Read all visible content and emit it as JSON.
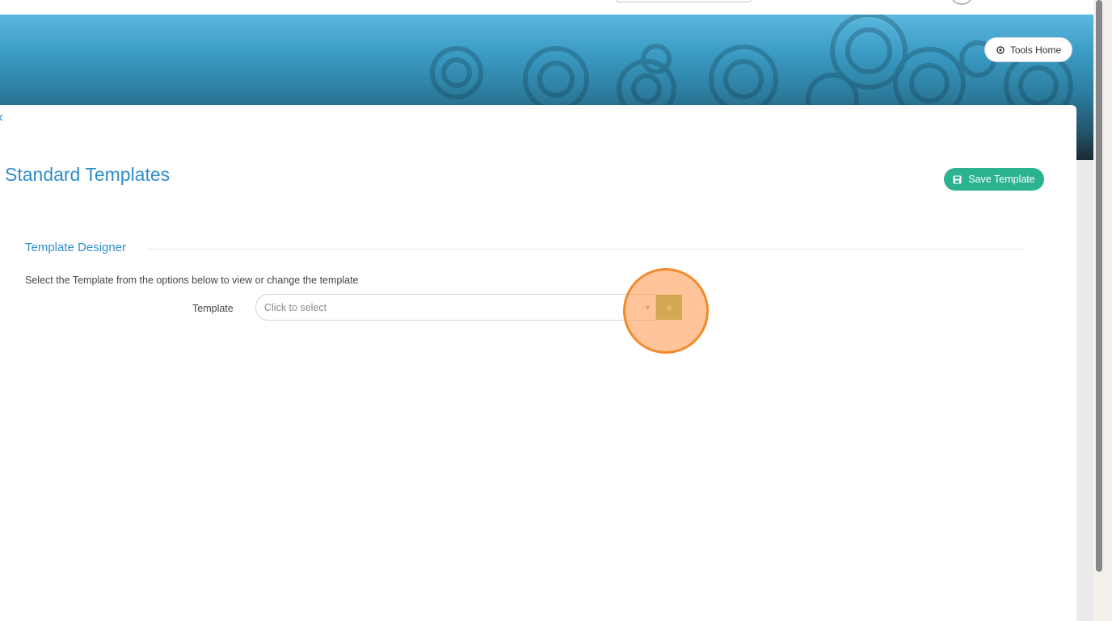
{
  "header": {
    "tools_home_label": "Tools Home",
    "banner_start": "#5bb8df",
    "banner_end": "#1b2a33"
  },
  "page": {
    "back_glyph": "‹",
    "title": "Standard Templates",
    "save_label": "Save Template"
  },
  "designer": {
    "section_title": "Template Designer",
    "instructions": "Select the Template from the options below to view or change the template",
    "template_label": "Template",
    "template_placeholder": "Click to select",
    "caret_glyph": "▼",
    "add_glyph": "+"
  },
  "colors": {
    "accent_blue": "#2f8ec9",
    "save_green": "#2bb28f",
    "add_green": "#8cb544",
    "click_highlight": "#f28a2c"
  },
  "icons": [
    "gear-icon",
    "save-icon",
    "chevron-left-icon",
    "caret-down-icon",
    "plus-icon"
  ]
}
